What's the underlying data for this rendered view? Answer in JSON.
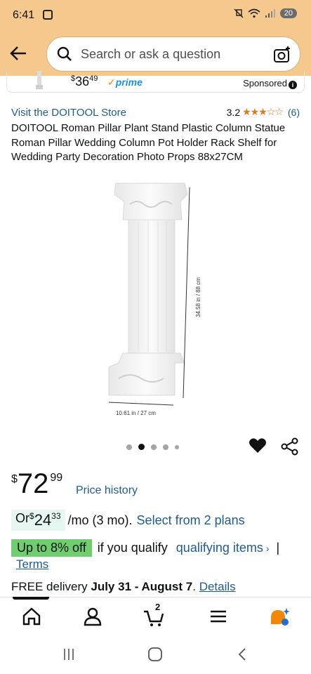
{
  "status_bar": {
    "time": "6:41",
    "battery": "20"
  },
  "header": {
    "search_placeholder": "Search or ask a question"
  },
  "sponsored_strip": {
    "price_symbol": "$",
    "price_whole": "36",
    "price_frac": "49",
    "prime_label": "prime",
    "sponsored_label": "Sponsored"
  },
  "product": {
    "store_link": "Visit the DOITOOL Store",
    "rating_value": "3.2",
    "rating_stars": 3.2,
    "rating_count": "(6)",
    "title": "DOITOOL Roman Pillar Plant Stand Plastic Column Statue Roman Pillar Wedding Column Pot Holder Rack Shelf for Wedding Party Decoration Photo Props 88x27CM",
    "image_dims": {
      "height_label": "34.58 in / 88 cm",
      "width_label": "10.61 in / 27 cm"
    },
    "image_count": 5,
    "active_image": 2
  },
  "pricing": {
    "symbol": "$",
    "whole": "72",
    "frac": "99",
    "history_link": "Price history",
    "monthly": {
      "prefix": "Or ",
      "symbol": "$",
      "whole": "24",
      "frac": "33",
      "suffix": "/mo (3 mo).",
      "plans_link": "Select from 2 plans"
    },
    "promo": {
      "badge": "Up to 8% off",
      "text": "if you qualify",
      "link": "qualifying items",
      "separator": "|",
      "terms": "Terms"
    }
  },
  "delivery": {
    "prefix": "FREE delivery ",
    "dates": "July 31 - August 7",
    "suffix": ". ",
    "details_link": "Details"
  },
  "bottom_nav": {
    "cart_count": "2"
  },
  "colors": {
    "header_bg": "#f5c98e",
    "link": "#1f5b8e",
    "star": "#de7921",
    "promo_green": "#6fcf6f",
    "monthly_bg": "#e6f7f1"
  }
}
